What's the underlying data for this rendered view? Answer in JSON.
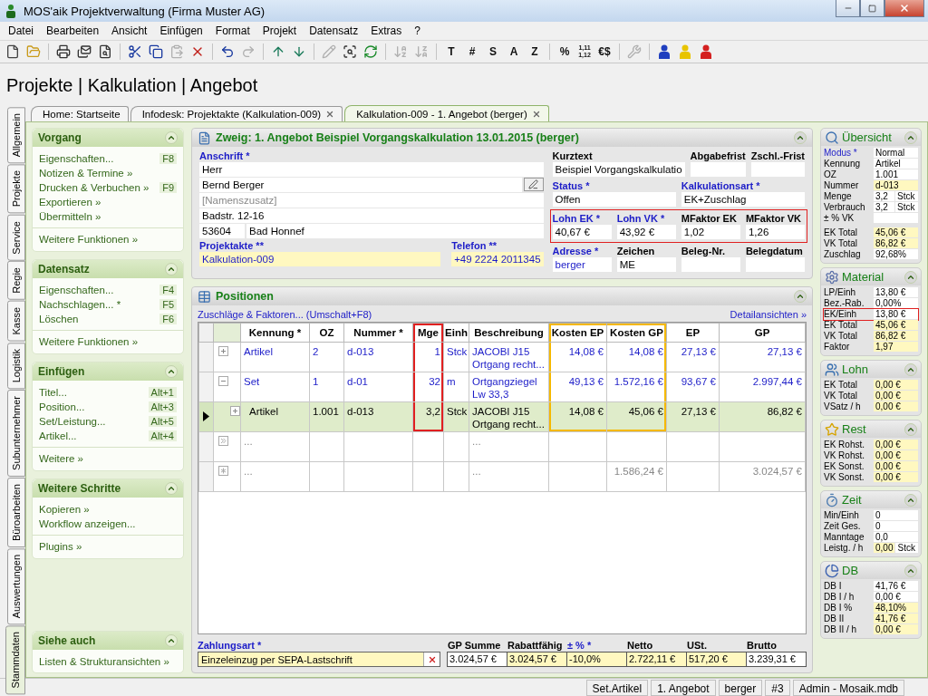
{
  "window": {
    "title": "MOS'aik Projektverwaltung (Firma Muster AG)"
  },
  "menu": [
    "Datei",
    "Bearbeiten",
    "Ansicht",
    "Einfügen",
    "Format",
    "Projekt",
    "Datensatz",
    "Extras",
    "?"
  ],
  "toolbar": [
    {
      "kind": "icon",
      "disabled": false
    },
    {
      "kind": "icon",
      "disabled": false
    },
    {
      "kind": "separator"
    },
    {
      "kind": "icon",
      "disabled": false
    },
    {
      "kind": "icon",
      "disabled": false
    },
    {
      "kind": "icon",
      "disabled": false
    },
    {
      "kind": "separator"
    },
    {
      "kind": "icon",
      "disabled": false
    },
    {
      "kind": "icon",
      "disabled": false
    },
    {
      "kind": "icon",
      "disabled": true
    },
    {
      "kind": "icon",
      "disabled": false
    },
    {
      "kind": "separator"
    },
    {
      "kind": "icon",
      "disabled": false
    },
    {
      "kind": "icon",
      "disabled": true
    },
    {
      "kind": "separator"
    },
    {
      "kind": "icon",
      "disabled": false
    },
    {
      "kind": "icon",
      "disabled": false
    },
    {
      "kind": "separator"
    },
    {
      "kind": "icon",
      "disabled": true
    },
    {
      "kind": "icon",
      "disabled": false
    },
    {
      "kind": "icon",
      "disabled": false
    },
    {
      "kind": "separator"
    },
    {
      "kind": "icon",
      "disabled": true
    },
    {
      "kind": "icon",
      "disabled": true
    },
    {
      "kind": "separator"
    },
    {
      "kind": "text",
      "label": "T",
      "disabled": false
    },
    {
      "kind": "text",
      "label": "#",
      "disabled": false
    },
    {
      "kind": "text",
      "label": "S",
      "disabled": false
    },
    {
      "kind": "text",
      "label": "A",
      "disabled": false
    },
    {
      "kind": "text",
      "label": "Z",
      "disabled": false
    },
    {
      "kind": "separator"
    },
    {
      "kind": "text",
      "label": "%",
      "disabled": false
    },
    {
      "kind": "text",
      "label": "1,11 1,12",
      "disabled": false
    },
    {
      "kind": "text",
      "label": "€$",
      "disabled": false
    },
    {
      "kind": "separator"
    },
    {
      "kind": "icon",
      "disabled": true
    },
    {
      "kind": "separator"
    },
    {
      "kind": "icon",
      "disabled": false,
      "color": "#1f3fbf"
    },
    {
      "kind": "icon",
      "disabled": false,
      "color": "#e8c400"
    },
    {
      "kind": "icon",
      "disabled": false,
      "color": "#d42020"
    }
  ],
  "heading": "Projekte | Kalkulation | Angebot",
  "side_tabs": [
    {
      "label": "Allgemein",
      "selected": false
    },
    {
      "label": "Projekte",
      "selected": false
    },
    {
      "label": "Service",
      "selected": false
    },
    {
      "label": "Regie",
      "selected": false
    },
    {
      "label": "Kasse",
      "selected": false
    },
    {
      "label": "Logistik",
      "selected": false
    },
    {
      "label": "Subunternehmer",
      "selected": false
    },
    {
      "label": "Büroarbeiten",
      "selected": false
    },
    {
      "label": "Auswertungen",
      "selected": false
    },
    {
      "label": "Stammdaten",
      "selected": true
    }
  ],
  "tabs": [
    {
      "label": "Home: Startseite",
      "closable": false,
      "selected": false
    },
    {
      "label": "Infodesk: Projektakte (Kalkulation-009)",
      "closable": true,
      "selected": false
    },
    {
      "label": "Kalkulation-009 - 1. Angebot (berger)",
      "closable": true,
      "selected": true
    }
  ],
  "sidebar": [
    {
      "title": "Vorgang",
      "items": [
        {
          "label": "Eigenschaften...",
          "shortcut": "F8"
        },
        {
          "label": "Notizen & Termine »"
        },
        {
          "label": "Drucken & Verbuchen »",
          "shortcut": "F9"
        },
        {
          "label": "Exportieren »"
        },
        {
          "label": "Übermitteln »"
        }
      ],
      "more": [
        "Weitere Funktionen »"
      ]
    },
    {
      "title": "Datensatz",
      "items": [
        {
          "label": "Eigenschaften...",
          "shortcut": "F4"
        },
        {
          "label": "Nachschlagen... *",
          "shortcut": "F5"
        },
        {
          "label": "Löschen",
          "shortcut": "F6"
        }
      ],
      "more": [
        "Weitere Funktionen »"
      ]
    },
    {
      "title": "Einfügen",
      "items": [
        {
          "label": "Titel...",
          "shortcut": "Alt+1"
        },
        {
          "label": "Position...",
          "shortcut": "Alt+3"
        },
        {
          "label": "Set/Leistung...",
          "shortcut": "Alt+5"
        },
        {
          "label": "Artikel...",
          "shortcut": "Alt+4"
        }
      ],
      "more": [
        "Weitere »"
      ]
    },
    {
      "title": "Weitere Schritte",
      "items": [
        {
          "label": "Kopieren »"
        },
        {
          "label": "Workflow anzeigen..."
        }
      ],
      "more": [
        "Plugins »"
      ]
    },
    {
      "title": "Siehe auch",
      "items": [
        {
          "label": "Listen & Strukturansichten »"
        }
      ]
    }
  ],
  "branch": {
    "title": "Zweig: 1. Angebot Beispiel Vorgangskalkulation 13.01.2015 (berger)",
    "address": {
      "label": "Anschrift *",
      "required": true,
      "lines": [
        {
          "value": "Herr",
          "kind": "plain"
        },
        {
          "value": "Bernd Berger",
          "kind": "lookup"
        },
        {
          "placeholder": "[Namenszusatz]",
          "kind": "plain"
        },
        {
          "value": "Badstr. 12-16",
          "kind": "plain"
        }
      ],
      "zip": "53604",
      "city": "Bad Honnef"
    },
    "contact": [
      {
        "label": "Projektakte **",
        "required": true,
        "value": "Kalkulation-009",
        "link": true,
        "highlight": true
      },
      {
        "label": "Telefon **",
        "required": true,
        "value": "+49 2224 2011345",
        "link": true,
        "highlight": true
      }
    ],
    "details": [
      {
        "outlined": false,
        "fields": [
          {
            "label": "Kurztext",
            "required": false,
            "value": "Beispiel Vorgangskalkulatio",
            "link": false,
            "highlight": false
          },
          {
            "label": "Abgabefrist",
            "required": false,
            "highlight": false
          },
          {
            "label": "Zschl.-Frist",
            "required": false,
            "highlight": false
          }
        ]
      },
      {
        "outlined": false,
        "fields": [
          {
            "label": "Status *",
            "required": true,
            "value": "Offen",
            "link": false,
            "highlight": false
          },
          {
            "label": "Kalkulationsart *",
            "required": true,
            "value": "EK+Zuschlag",
            "link": false,
            "highlight": false
          }
        ]
      },
      {
        "outlined": true,
        "fields": [
          {
            "label": "Lohn EK *",
            "required": true,
            "value": "40,67 €",
            "link": false,
            "highlight": false
          },
          {
            "label": "Lohn VK *",
            "required": true,
            "value": "43,92 €",
            "link": false,
            "highlight": false
          },
          {
            "label": "MFaktor EK",
            "required": false,
            "value": "1,02",
            "link": false,
            "highlight": false
          },
          {
            "label": "MFaktor VK",
            "required": false,
            "value": "1,26",
            "link": false,
            "highlight": false
          }
        ]
      },
      {
        "outlined": false,
        "fields": [
          {
            "label": "Adresse *",
            "required": true,
            "value": "berger",
            "link": true,
            "highlight": false
          },
          {
            "label": "Zeichen",
            "required": false,
            "value": "ME",
            "link": false,
            "highlight": false
          },
          {
            "label": "Beleg-Nr.",
            "required": false,
            "highlight": false
          },
          {
            "label": "Belegdatum",
            "required": false,
            "highlight": false
          }
        ]
      }
    ]
  },
  "positions": {
    "title": "Positionen",
    "links": [
      "Zuschläge & Faktoren... (Umschalt+F8)",
      "Detailansichten »"
    ],
    "table": {
      "columns": [
        {
          "label": "Kennung *",
          "kind": "text"
        },
        {
          "label": "OZ",
          "kind": "text"
        },
        {
          "label": "Nummer *",
          "kind": "text"
        },
        {
          "label": "Mge",
          "kind": "number",
          "color": "#e02020"
        },
        {
          "label": "Einh",
          "kind": "text"
        },
        {
          "label": "Beschreibung",
          "kind": "text"
        },
        {
          "label": "Kosten EP",
          "kind": "number",
          "color": "#f5b800"
        },
        {
          "label": "Kosten GP",
          "kind": "number",
          "color": "#f5b800"
        },
        {
          "label": "EP",
          "kind": "number"
        },
        {
          "label": "GP",
          "kind": "number"
        }
      ],
      "rows": [
        {
          "kind": "item",
          "selected": false,
          "expanded": false,
          "cells": [
            "Artikel",
            "2",
            "d-013",
            "1",
            "Stck",
            "JACOBI J15 Ortgang recht...",
            "14,08 €",
            "14,08 €",
            "27,13 €",
            "27,13 €"
          ]
        },
        {
          "kind": "item",
          "selected": false,
          "expanded": true,
          "cells": [
            "Set",
            "1",
            "d-01",
            "32",
            "m",
            "Ortgangziegel Lw 33,3",
            "49,13 €",
            "1.572,16 €",
            "93,67 €",
            "2.997,44 €"
          ],
          "children": [
            {
              "kind": "item",
              "selected": true,
              "expanded": false,
              "cells": [
                "Artikel",
                "1.001",
                "d-013",
                "3,2",
                "Stck",
                "JACOBI J15 Ortgang recht...",
                "14,08 €",
                "45,06 €",
                "27,13 €",
                "86,82 €"
              ]
            }
          ]
        },
        {
          "kind": "placeholder",
          "cells": [
            "...",
            null,
            null,
            null,
            null,
            "...",
            null,
            null,
            null,
            null
          ]
        },
        {
          "kind": "total",
          "cells": [
            "...",
            null,
            null,
            null,
            null,
            "...",
            null,
            "1.586,24 €",
            null,
            "3.024,57 €"
          ]
        }
      ]
    },
    "payment": {
      "label": "Zahlungsart *",
      "required": true,
      "value": "Einzeleinzug per SEPA-Lastschrift",
      "highlight": true
    },
    "totals": [
      {
        "label": "GP Summe",
        "required": false,
        "value": "3.024,57 €",
        "highlight": false
      },
      {
        "label": "Rabattfähig",
        "required": false,
        "value": "3.024,57 €",
        "highlight": true
      },
      {
        "label": "± % *",
        "required": true,
        "value": "-10,0%",
        "highlight": true
      },
      {
        "label": "Netto",
        "required": false,
        "value": "2.722,11 €",
        "highlight": true
      },
      {
        "label": "USt.",
        "required": false,
        "value": "517,20 €",
        "highlight": true
      },
      {
        "label": "Brutto",
        "required": false,
        "value": "3.239,31 €",
        "highlight": false
      }
    ]
  },
  "info_panels": [
    {
      "title": "Übersicht",
      "groups": [
        [
          {
            "label": "Modus *",
            "required": true,
            "value": "Normal",
            "highlight": false,
            "outlined": false
          },
          {
            "label": "Kennung",
            "required": false,
            "value": "Artikel",
            "highlight": false,
            "outlined": false
          },
          {
            "label": "OZ",
            "required": false,
            "value": "1.001",
            "highlight": false,
            "outlined": false
          },
          {
            "label": "Nummer",
            "required": false,
            "value": "d-013",
            "highlight": true,
            "outlined": false
          },
          {
            "label": "Menge",
            "required": false,
            "value": "3,2",
            "unit": "Stck",
            "highlight": false,
            "outlined": false
          },
          {
            "label": "Verbrauch",
            "required": false,
            "value": "3,2",
            "unit": "Stck",
            "highlight": false,
            "outlined": false
          },
          {
            "label": "± % VK",
            "required": false,
            "highlight": false,
            "outlined": false
          }
        ],
        [
          {
            "label": "EK Total",
            "required": false,
            "value": "45,06 €",
            "highlight": true,
            "outlined": false
          },
          {
            "label": "VK Total",
            "required": false,
            "value": "86,82 €",
            "highlight": true,
            "outlined": false
          },
          {
            "label": "Zuschlag",
            "required": false,
            "value": "92,68%",
            "highlight": false,
            "outlined": false
          }
        ]
      ]
    },
    {
      "title": "Material",
      "groups": [
        [
          {
            "label": "LP/Einh",
            "required": false,
            "value": "13,80 €",
            "highlight": false,
            "outlined": false
          },
          {
            "label": "Bez.-Rab.",
            "required": false,
            "value": "0,00%",
            "highlight": false,
            "outlined": false
          },
          {
            "label": "EK/Einh",
            "required": false,
            "value": "13,80 €",
            "highlight": false,
            "outlined": true
          },
          {
            "label": "EK Total",
            "required": false,
            "value": "45,06 €",
            "highlight": true,
            "outlined": false
          },
          {
            "label": "VK Total",
            "required": false,
            "value": "86,82 €",
            "highlight": true,
            "outlined": false
          },
          {
            "label": "Faktor",
            "required": false,
            "value": "1,97",
            "highlight": true,
            "outlined": false
          }
        ]
      ]
    },
    {
      "title": "Lohn",
      "groups": [
        [
          {
            "label": "EK Total",
            "required": false,
            "value": "0,00 €",
            "highlight": true,
            "outlined": false
          },
          {
            "label": "VK Total",
            "required": false,
            "value": "0,00 €",
            "highlight": true,
            "outlined": false
          },
          {
            "label": "VSatz / h",
            "required": false,
            "value": "0,00 €",
            "highlight": true,
            "outlined": false
          }
        ]
      ]
    },
    {
      "title": "Rest",
      "groups": [
        [
          {
            "label": "EK Rohst.",
            "required": false,
            "value": "0,00 €",
            "highlight": true,
            "outlined": false
          },
          {
            "label": "VK Rohst.",
            "required": false,
            "value": "0,00 €",
            "highlight": true,
            "outlined": false
          },
          {
            "label": "EK Sonst.",
            "required": false,
            "value": "0,00 €",
            "highlight": true,
            "outlined": false
          },
          {
            "label": "VK Sonst.",
            "required": false,
            "value": "0,00 €",
            "highlight": true,
            "outlined": false
          }
        ]
      ]
    },
    {
      "title": "Zeit",
      "groups": [
        [
          {
            "label": "Min/Einh",
            "required": false,
            "value": "0",
            "highlight": false,
            "outlined": false
          },
          {
            "label": "Zeit Ges.",
            "required": false,
            "value": "0",
            "highlight": false,
            "outlined": false
          },
          {
            "label": "Manntage",
            "required": false,
            "value": "0,0",
            "highlight": false,
            "outlined": false
          },
          {
            "label": "Leistg. / h",
            "required": false,
            "value": "0,00",
            "unit": "Stck",
            "highlight": true,
            "outlined": false
          }
        ]
      ]
    },
    {
      "title": "DB",
      "groups": [
        [
          {
            "label": "DB I",
            "required": false,
            "value": "41,76 €",
            "highlight": false,
            "outlined": false
          },
          {
            "label": "DB I / h",
            "required": false,
            "value": "0,00 €",
            "highlight": false,
            "outlined": false
          },
          {
            "label": "DB I %",
            "required": false,
            "value": "48,10%",
            "highlight": true,
            "outlined": false
          },
          {
            "label": "DB II",
            "required": false,
            "value": "41,76 €",
            "highlight": true,
            "outlined": false
          },
          {
            "label": "DB II / h",
            "required": false,
            "value": "0,00 €",
            "highlight": true,
            "outlined": false
          }
        ]
      ]
    }
  ],
  "status_bar": [
    "Set.Artikel",
    "1. Angebot",
    "berger",
    "#3",
    "Admin - Mosaik.mdb"
  ]
}
